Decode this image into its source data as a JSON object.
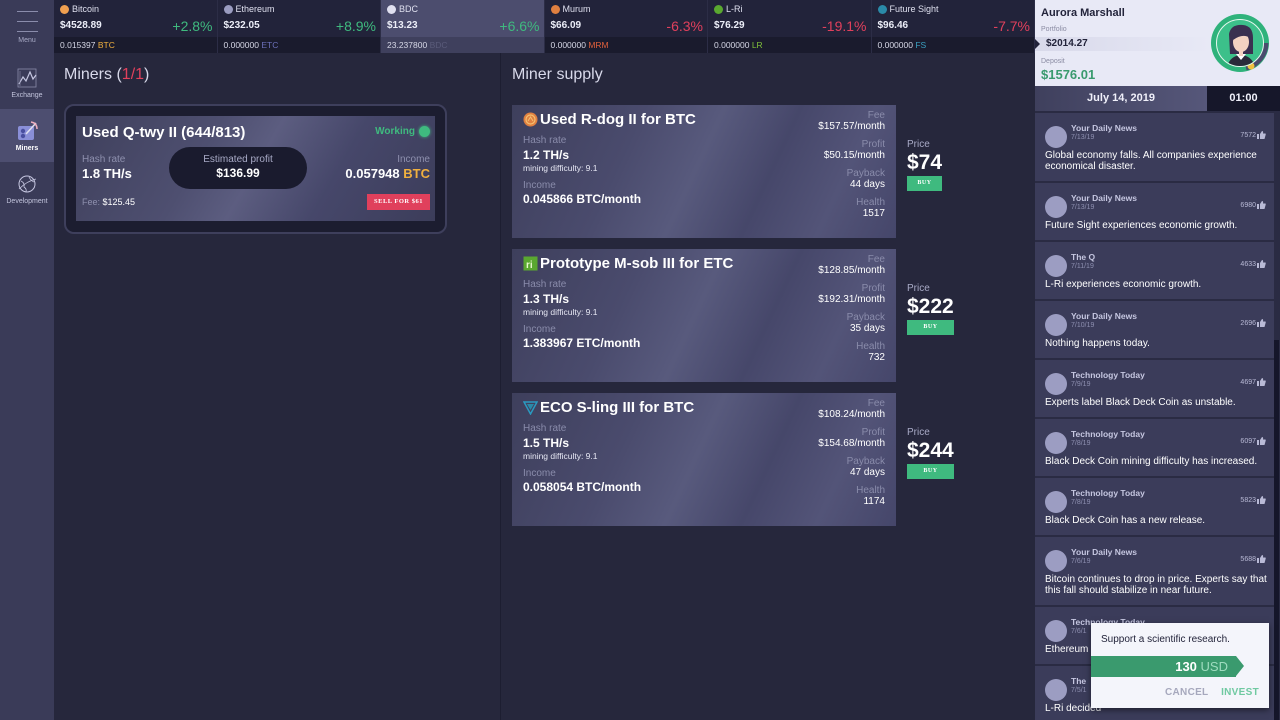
{
  "sidebar": {
    "menu_label": "Menu",
    "items": [
      {
        "label": "Exchange",
        "icon": "chart-icon",
        "active": false
      },
      {
        "label": "Miners",
        "icon": "miner-icon",
        "active": true
      },
      {
        "label": "Development",
        "icon": "globe-icon",
        "active": false
      }
    ]
  },
  "ticker": [
    {
      "name": "Bitcoin",
      "price": "$4528.89",
      "change": "+2.8%",
      "trend": "up",
      "holding": "0.015397",
      "symbol": "BTC",
      "symbol_color": "#f0b03f",
      "icon_color": "#f0a050",
      "active": false
    },
    {
      "name": "Ethereum",
      "price": "$232.05",
      "change": "+8.9%",
      "trend": "up",
      "holding": "0.000000",
      "symbol": "ETC",
      "symbol_color": "#6b6fb8",
      "icon_color": "#9a9cc0",
      "active": false
    },
    {
      "name": "BDC",
      "price": "$13.23",
      "change": "+6.6%",
      "trend": "up",
      "holding": "23.237800",
      "symbol": "BDC",
      "symbol_color": "#5a5b7a",
      "icon_color": "#e0e0f0",
      "active": true
    },
    {
      "name": "Murum",
      "price": "$66.09",
      "change": "-6.3%",
      "trend": "down",
      "holding": "0.000000",
      "symbol": "MRM",
      "symbol_color": "#e0603c",
      "icon_color": "#e08040",
      "active": false
    },
    {
      "name": "L-Ri",
      "price": "$76.29",
      "change": "-19.1%",
      "trend": "down",
      "holding": "0.000000",
      "symbol": "LR",
      "symbol_color": "#7fc03a",
      "icon_color": "#5aa830",
      "active": false
    },
    {
      "name": "Future Sight",
      "price": "$96.46",
      "change": "-7.7%",
      "trend": "down",
      "holding": "0.000000",
      "symbol": "FS",
      "symbol_color": "#3aa0c0",
      "icon_color": "#2a8aa8",
      "active": false
    }
  ],
  "profile": {
    "name": "Aurora Marshall",
    "portfolio_label": "Portfolio",
    "portfolio_value": "$2014.27",
    "deposit_label": "Deposit",
    "deposit_value": "$1576.01"
  },
  "datebar": {
    "date": "July 14, 2019",
    "time": "01:00"
  },
  "miners": {
    "title": "Miners",
    "count": "1/1",
    "owned": {
      "name": "Used Q-twy II (644/813)",
      "status": "Working",
      "hash_label": "Hash rate",
      "hash_value": "1.8 TH/s",
      "profit_label": "Estimated profit",
      "profit_value": "$136.99",
      "income_label": "Income",
      "income_value": "0.057948",
      "income_symbol": "BTC",
      "fee_label": "Fee:",
      "fee_value": "$125.45",
      "sell_label": "SELL FOR $61"
    }
  },
  "supply": {
    "title": "Miner supply",
    "items": [
      {
        "name": "Used R-dog II for BTC",
        "coin": "murum-icon",
        "hash_label": "Hash rate",
        "hash": "1.2 TH/s",
        "difficulty": "mining difficulty: 9.1",
        "income_label": "Income",
        "income": "0.045866 BTC/month",
        "fee_label": "Fee",
        "fee": "$157.57/month",
        "profit_label": "Profit",
        "profit": "$50.15/month",
        "payback_label": "Payback",
        "payback": "44 days",
        "health_label": "Health",
        "health": "1517",
        "price_label": "Price",
        "price": "$74",
        "buy_label": "BUY"
      },
      {
        "name": "Prototype M-sob III for ETC",
        "coin": "lri-icon",
        "hash_label": "Hash rate",
        "hash": "1.3 TH/s",
        "difficulty": "mining difficulty: 9.1",
        "income_label": "Income",
        "income": "1.383967 ETC/month",
        "fee_label": "Fee",
        "fee": "$128.85/month",
        "profit_label": "Profit",
        "profit": "$192.31/month",
        "payback_label": "Payback",
        "payback": "35 days",
        "health_label": "Health",
        "health": "732",
        "price_label": "Price",
        "price": "$222",
        "buy_label": "BUY"
      },
      {
        "name": "ECO S-ling III for BTC",
        "coin": "future-sight-icon",
        "hash_label": "Hash rate",
        "hash": "1.5 TH/s",
        "difficulty": "mining difficulty: 9.1",
        "income_label": "Income",
        "income": "0.058054 BTC/month",
        "fee_label": "Fee",
        "fee": "$108.24/month",
        "profit_label": "Profit",
        "profit": "$154.68/month",
        "payback_label": "Payback",
        "payback": "47 days",
        "health_label": "Health",
        "health": "1174",
        "price_label": "Price",
        "price": "$244",
        "buy_label": "BUY"
      }
    ]
  },
  "news": [
    {
      "source": "Your Daily News",
      "date": "7/13/19",
      "likes": "7572",
      "text": "Global economy falls. All companies experience economical disaster."
    },
    {
      "source": "Your Daily News",
      "date": "7/13/19",
      "likes": "6980",
      "text": "Future Sight experiences economic growth."
    },
    {
      "source": "The Q",
      "date": "7/11/19",
      "likes": "4633",
      "text": "L-Ri experiences economic growth."
    },
    {
      "source": "Your Daily News",
      "date": "7/10/19",
      "likes": "2696",
      "text": "Nothing happens today."
    },
    {
      "source": "Technology Today",
      "date": "7/9/19",
      "likes": "4697",
      "text": "Experts label Black Deck Coin as unstable."
    },
    {
      "source": "Technology Today",
      "date": "7/8/19",
      "likes": "6097",
      "text": "Black Deck Coin mining difficulty has increased."
    },
    {
      "source": "Technology Today",
      "date": "7/8/19",
      "likes": "5823",
      "text": "Black Deck Coin has a new release."
    },
    {
      "source": "Your Daily News",
      "date": "7/6/19",
      "likes": "5688",
      "text": "Bitcoin continues to drop in price. Experts say that this fall should stabilize in near future."
    },
    {
      "source": "Technology Today",
      "date": "7/6/1",
      "likes": "",
      "text": "Ethereum"
    },
    {
      "source": "The",
      "date": "7/5/1",
      "likes": "",
      "text": "L-Ri decided"
    }
  ],
  "dialog": {
    "message": "Support a scientific research.",
    "amount": "130",
    "currency": "USD",
    "cancel_label": "CANCEL",
    "invest_label": "INVEST"
  }
}
